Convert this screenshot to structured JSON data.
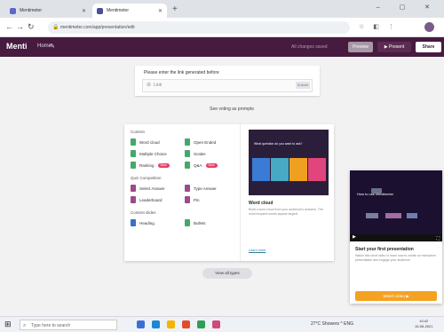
{
  "browser": {
    "tabs": [
      {
        "label": "Mentimeter",
        "favicon_color": "#5a68c8"
      },
      {
        "label": "Mentimeter",
        "favicon_color": "#4a4e9a"
      }
    ],
    "new_tab_symbol": "+",
    "window_controls": "– ▢ ✕",
    "url": "mentimeter.com/app/presentation/edit"
  },
  "app": {
    "logo": "Menti",
    "header_items": [
      "Home",
      "✎"
    ],
    "status": "All changes saved",
    "buttons": {
      "preview": "Preview",
      "present": "▶ Present",
      "share": "Share"
    }
  },
  "question": {
    "title": "Please enter the link generated before",
    "placeholder": "Link",
    "submit": "Submit"
  },
  "see_prompt": "See voting as prompts",
  "panel": {
    "sections": [
      {
        "title": "Content",
        "items": [
          {
            "label": "Word cloud",
            "color": "#45a86b"
          },
          {
            "label": "Open Ended",
            "color": "#45a86b"
          },
          {
            "label": "Multiple Choice",
            "color": "#45a86b"
          },
          {
            "label": "Scales",
            "color": "#45a86b"
          },
          {
            "label": "Ranking",
            "color": "#45a86b",
            "badge": "New"
          },
          {
            "label": "Q&A",
            "color": "#45a86b",
            "badge": "New"
          }
        ]
      },
      {
        "title": "Quiz Competition",
        "items": [
          {
            "label": "Select Answer",
            "color": "#9c4a8a"
          },
          {
            "label": "Type Answer",
            "color": "#9c4a8a"
          },
          {
            "label": "Leaderboard",
            "color": "#9c4a8a"
          },
          {
            "label": "Pin",
            "color": "#9c4a8a"
          }
        ]
      },
      {
        "title": "Content slides",
        "items": [
          {
            "label": "Heading",
            "color": "#3a6fc4"
          },
          {
            "label": "Bullets",
            "color": "#45a86b"
          }
        ]
      }
    ],
    "preview": {
      "question": "What question do you want to ask?",
      "title": "Word cloud",
      "description": "Build a word cloud from your audience's answers. The most frequent words appear largest.",
      "link": "Learn more",
      "bar_colors": [
        "#3a7bd5",
        "#48a9c5",
        "#f0a020",
        "#e0457b"
      ]
    }
  },
  "view_all": "View all types",
  "popup": {
    "video_text": "How to use Mentimeter",
    "title": "Start your first presentation",
    "description": "Watch this short video to learn how to create an interactive presentation and engage your audience.",
    "button": "Watch video ▶",
    "bar_colors": [
      "#7a7fa0",
      "#a06ea0",
      "#6d7fb0"
    ]
  },
  "taskbar": {
    "start_symbol": "⊞",
    "search_placeholder": "Type here to search",
    "app_colors": [
      "#3a6fd8",
      "#1c88d5",
      "#f4b400",
      "#e04b2e",
      "#2f9e55",
      "#d04a7a"
    ],
    "tray_text": "27°C  Showers  ^  ENG",
    "time": "10:42",
    "date": "15-06-2021"
  }
}
